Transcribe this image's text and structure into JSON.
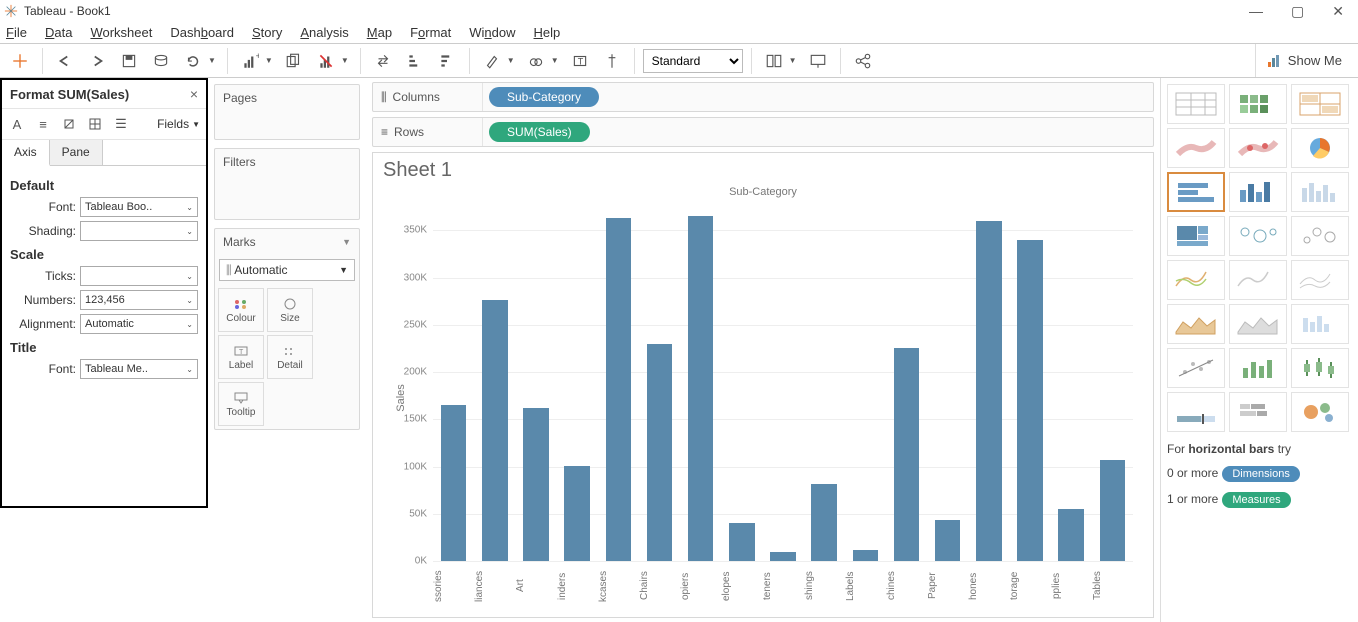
{
  "window": {
    "title": "Tableau - Book1"
  },
  "menu": [
    "File",
    "Data",
    "Worksheet",
    "Dashboard",
    "Story",
    "Analysis",
    "Map",
    "Format",
    "Window",
    "Help"
  ],
  "toolbar": {
    "fit": "Standard",
    "showme": "Show Me"
  },
  "format_panel": {
    "title": "Format SUM(Sales)",
    "fields_label": "Fields",
    "tabs": {
      "axis": "Axis",
      "pane": "Pane"
    },
    "sections": {
      "default": "Default",
      "scale": "Scale",
      "title": "Title"
    },
    "labels": {
      "font": "Font:",
      "shading": "Shading:",
      "ticks": "Ticks:",
      "numbers": "Numbers:",
      "alignment": "Alignment:"
    },
    "values": {
      "default_font": "Tableau Boo..",
      "shading": "",
      "ticks": "",
      "numbers": "123,456",
      "alignment": "Automatic",
      "title_font": "Tableau Me.."
    }
  },
  "shelves": {
    "pages": "Pages",
    "filters": "Filters",
    "marks": "Marks",
    "marks_type": "Automatic",
    "mark_cells": [
      "Colour",
      "Size",
      "Label",
      "Detail",
      "Tooltip"
    ]
  },
  "columns_label": "Columns",
  "rows_label": "Rows",
  "columns_pill": "Sub-Category",
  "rows_pill": "SUM(Sales)",
  "sheet_title": "Sheet 1",
  "showme_panel": {
    "hint_prefix": "For ",
    "hint_bold": "horizontal bars",
    "hint_suffix": " try",
    "line1": "0 or more",
    "pill1": "Dimensions",
    "line2": "1 or more",
    "pill2": "Measures"
  },
  "chart_data": {
    "type": "bar",
    "title": "Sub-Category",
    "xlabel": "Sub-Category",
    "ylabel": "Sales",
    "ylim": [
      0,
      380000
    ],
    "y_ticks": [
      0,
      50000,
      100000,
      150000,
      200000,
      250000,
      300000,
      350000
    ],
    "y_tick_labels": [
      "0K",
      "50K",
      "100K",
      "150K",
      "200K",
      "250K",
      "300K",
      "350K"
    ],
    "categories": [
      "Accessories",
      "Appliances",
      "Art",
      "Binders",
      "Bookcases",
      "Chairs",
      "Copiers",
      "Envelopes",
      "Fasteners",
      "Furnishings",
      "Labels",
      "Machines",
      "Paper",
      "Phones",
      "Storage",
      "Supplies",
      "Tables"
    ],
    "x_display": [
      "ssories",
      "liances",
      "Art",
      "inders",
      "kcases",
      "Chairs",
      "opiers",
      "elopes",
      "teners",
      "shings",
      "Labels",
      "chines",
      "Paper",
      "hones",
      "torage",
      "pplies",
      "Tables"
    ],
    "values": [
      165000,
      276000,
      162000,
      101000,
      363000,
      230000,
      365000,
      40000,
      10000,
      82000,
      12000,
      225000,
      43000,
      360000,
      340000,
      55000,
      107000
    ]
  }
}
